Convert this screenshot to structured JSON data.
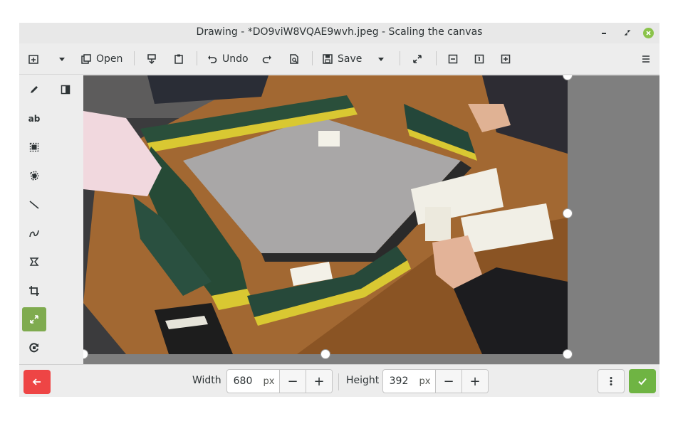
{
  "window": {
    "title": "Drawing - *DO9viW8VQAE9wvh.jpeg - Scaling the canvas"
  },
  "toolbar": {
    "open_label": "Open",
    "undo_label": "Undo",
    "save_label": "Save"
  },
  "tools": [
    {
      "name": "pencil",
      "icon": "pencil-icon"
    },
    {
      "name": "text",
      "icon": "text-icon",
      "glyph": "ab"
    },
    {
      "name": "rectangle-selection",
      "icon": "rect-select-icon"
    },
    {
      "name": "free-selection",
      "icon": "free-select-icon"
    },
    {
      "name": "line",
      "icon": "line-icon"
    },
    {
      "name": "curve",
      "icon": "curve-icon"
    },
    {
      "name": "free-shape",
      "icon": "shape-icon"
    },
    {
      "name": "crop",
      "icon": "crop-icon"
    },
    {
      "name": "scale",
      "icon": "scale-icon",
      "active": true
    },
    {
      "name": "rotate",
      "icon": "rotate-icon"
    }
  ],
  "bottom": {
    "width_label": "Width",
    "width_value": "680",
    "height_label": "Height",
    "height_value": "392",
    "unit": "px",
    "minus": "−",
    "plus": "+"
  },
  "colors": {
    "accent": "#7fab4f",
    "cancel": "#ee4545",
    "apply": "#6fb443",
    "close_dot": "#8bc34a"
  },
  "canvas": {
    "image_width": 680,
    "image_height": 392
  }
}
